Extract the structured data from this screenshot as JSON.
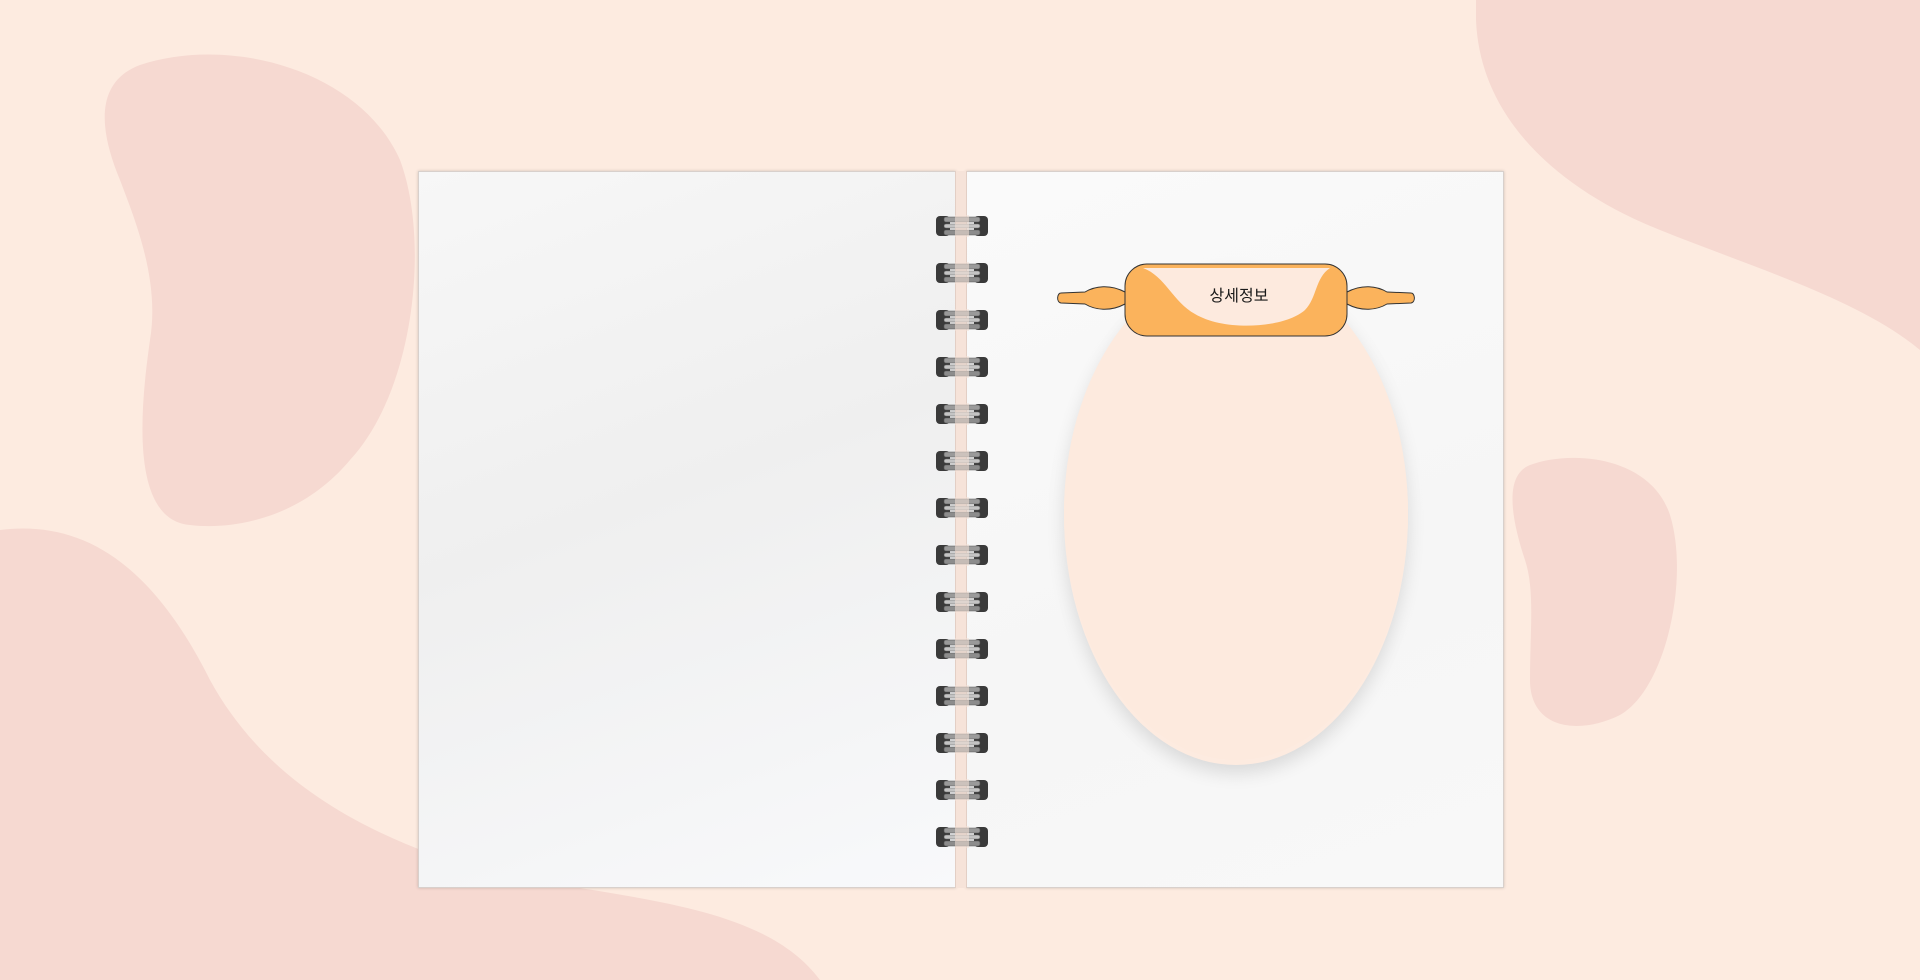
{
  "notebook": {
    "detail_label": "상세정보",
    "ring_count": 14
  },
  "colors": {
    "background": "#fdebe0",
    "blob": "#f6d9d1",
    "rolling_pin": "#fbb35c",
    "oval_panel": "#fdeade",
    "ring": "#3a3a3a"
  }
}
